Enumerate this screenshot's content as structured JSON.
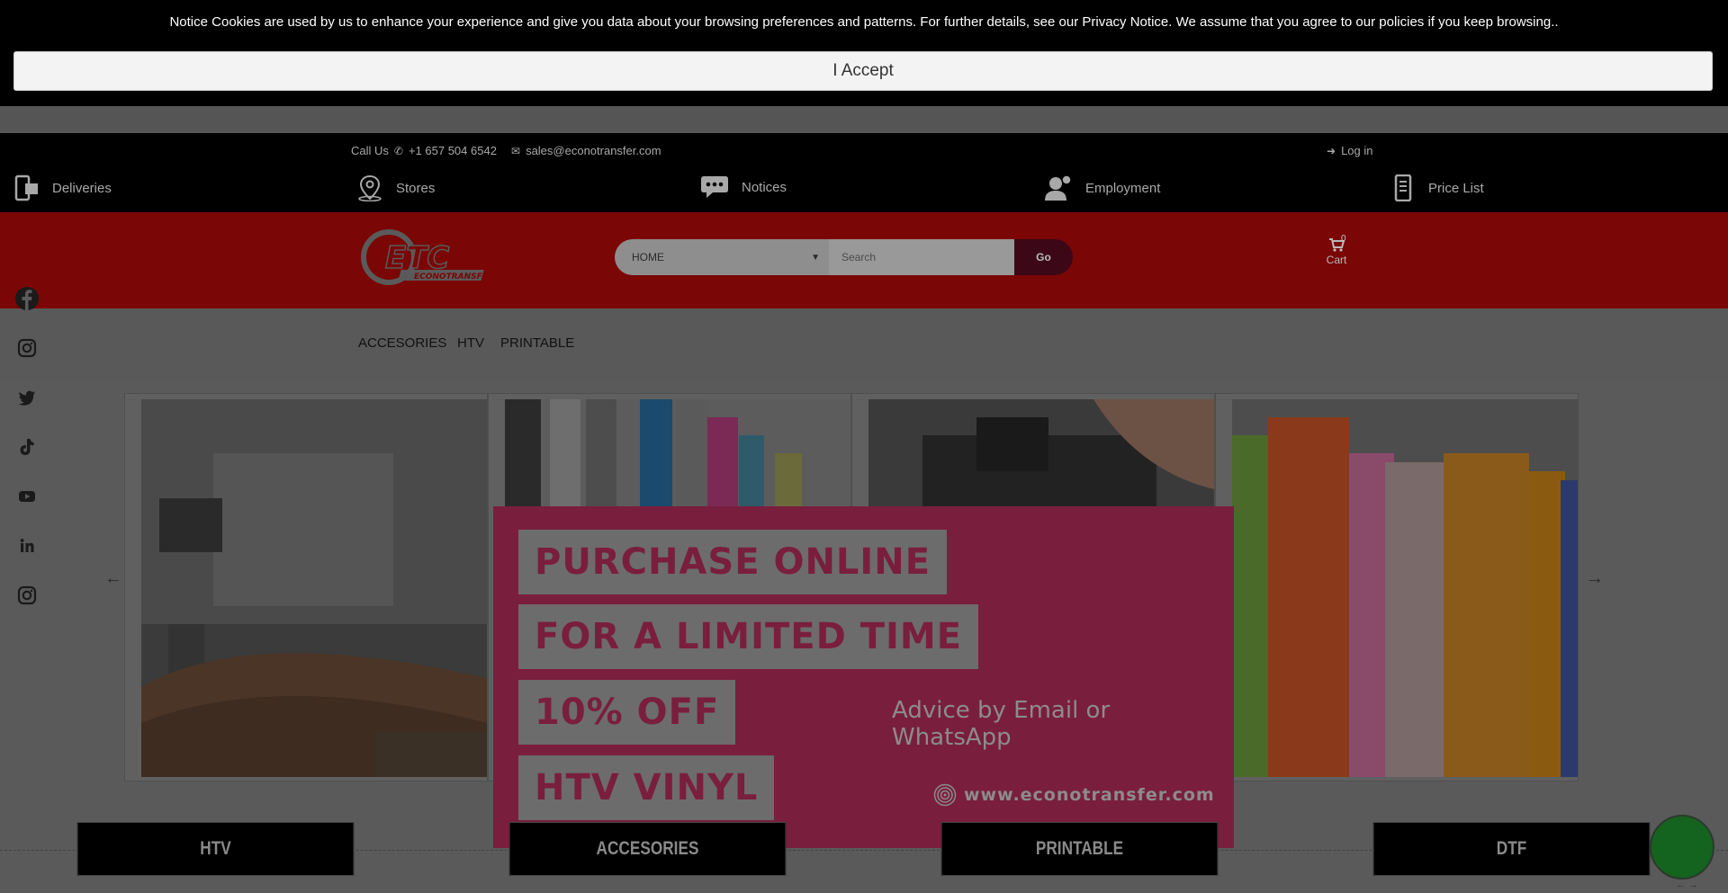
{
  "cookie": {
    "text": "Notice Cookies are used by us to enhance your experience and give you data about your browsing preferences and patterns. For further details, see our Privacy Notice. We assume that you agree to our policies if you keep browsing..",
    "accept_label": "I Accept"
  },
  "topbar": {
    "call_label": "Call Us",
    "phone": "+1 657 504 6542",
    "email": "sales@econotransfer.com",
    "login": "Log in"
  },
  "quick_links": [
    {
      "label": "Deliveries",
      "icon": "delivery-phone-icon"
    },
    {
      "label": "Stores",
      "icon": "map-pin-icon"
    },
    {
      "label": "Notices",
      "icon": "chat-bubble-icon"
    },
    {
      "label": "Employment",
      "icon": "employee-icon"
    },
    {
      "label": "Price List",
      "icon": "document-price-icon"
    }
  ],
  "header": {
    "logo_text": "ETC",
    "logo_sub": "ECONOTRANSFER",
    "category_select": "HOME",
    "search_placeholder": "Search",
    "go_label": "Go",
    "cart_label": "Cart",
    "cart_count": "0"
  },
  "nav": [
    "ACCESORIES",
    "HTV",
    "PRINTABLE"
  ],
  "social": [
    "facebook-icon",
    "instagram-icon",
    "twitter-icon",
    "tiktok-icon",
    "youtube-icon",
    "linkedin-icon",
    "instagram-icon"
  ],
  "promo": {
    "line1": "PURCHASE ONLINE",
    "line2": "FOR A LIMITED TIME",
    "line3": "10% OFF",
    "line4": "HTV VINYL",
    "advice": "Advice by Email or WhatsApp",
    "website": "www.econotransfer.com"
  },
  "carousel": {
    "prev": "←",
    "next": "→",
    "slides": [
      "printer-image",
      "vinyl-swatches-image",
      "heat-press-image",
      "vinyl-rolls-image"
    ]
  },
  "categories": [
    "HTV",
    "ACCESORIES",
    "PRINTABLE",
    "DTF"
  ],
  "colors": {
    "overlay_dim": "#000000",
    "brand_red": "#e20a0a",
    "promo_pink": "#d8386e",
    "whatsapp_green": "#25a23a"
  }
}
